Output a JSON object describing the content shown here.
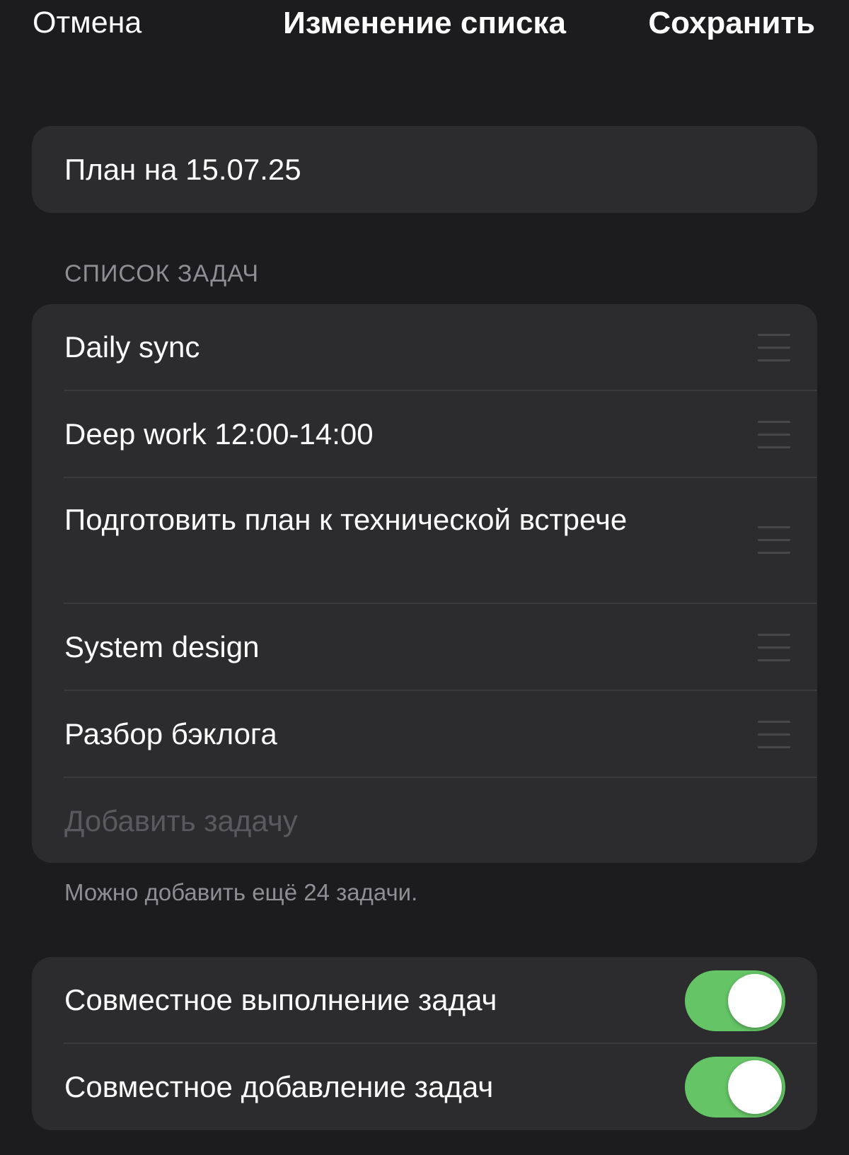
{
  "nav": {
    "cancel_label": "Отмена",
    "title": "Изменение списка",
    "save_label": "Сохранить"
  },
  "list": {
    "title_value": "План на 15.07.25"
  },
  "tasks_section": {
    "header": "СПИСОК ЗАДАЧ",
    "items": [
      {
        "label": "Daily sync"
      },
      {
        "label": "Deep work 12:00-14:00"
      },
      {
        "label": "Подготовить план к технической встрече"
      },
      {
        "label": "System design"
      },
      {
        "label": "Разбор бэклога"
      }
    ],
    "add_placeholder": "Добавить задачу",
    "footer_note": "Можно добавить ещё 24 задачи."
  },
  "settings": {
    "items": [
      {
        "label": "Совместное выполнение задач",
        "enabled": true
      },
      {
        "label": "Совместное добавление задач",
        "enabled": true
      }
    ]
  },
  "colors": {
    "background": "#1c1c1e",
    "card": "#2c2c2e",
    "toggle_on": "#65c466",
    "secondary_text": "#8e8e93"
  },
  "icons": {
    "reorder": "reorder-handle-icon"
  }
}
